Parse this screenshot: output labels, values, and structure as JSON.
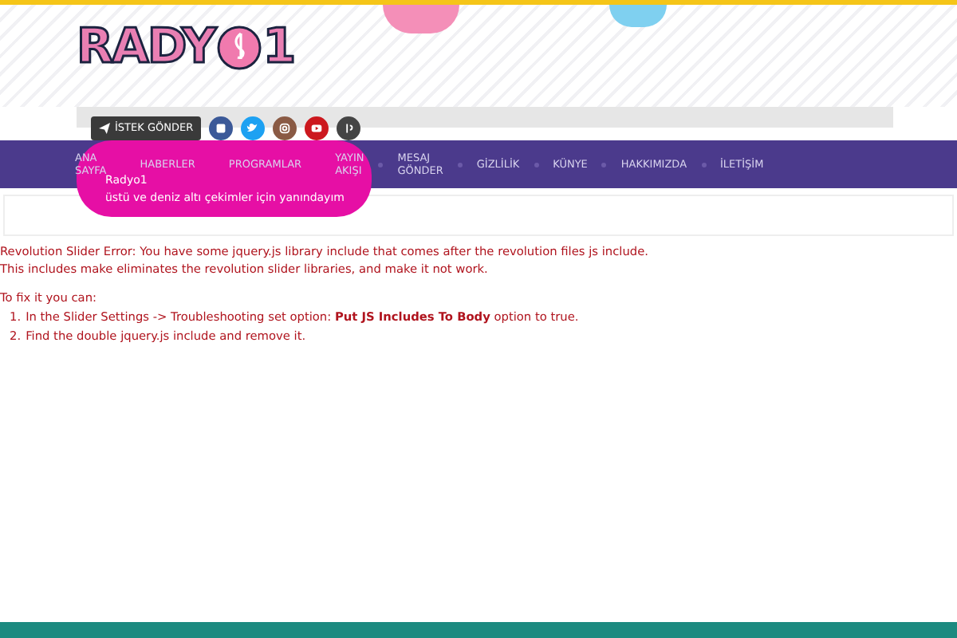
{
  "logo": {
    "text": "RADY",
    "suffix": "1"
  },
  "request_button": {
    "label": "İSTEK GÖNDER"
  },
  "social_links": [
    {
      "kind": "facebook",
      "color": "#3b5998"
    },
    {
      "kind": "twitter",
      "color": "#1da1f2"
    },
    {
      "kind": "instagram",
      "color": "#8a5a44"
    },
    {
      "kind": "youtube",
      "color": "#cc181e"
    },
    {
      "kind": "other",
      "color": "#444444"
    }
  ],
  "nav": {
    "items": [
      {
        "label": "ANA SAYFA"
      },
      {
        "label": "HABERLER"
      },
      {
        "label": "PROGRAMLAR"
      },
      {
        "label": "YAYIN AKIŞI"
      },
      {
        "label": "MESAJ GÖNDER"
      },
      {
        "label": "GİZLİLİK"
      },
      {
        "label": "KÜNYE"
      },
      {
        "label": "HAKKIMIZDA"
      },
      {
        "label": "İLETİŞİM"
      }
    ]
  },
  "popup": {
    "title": "Radyo1",
    "text": "üstü ve deniz altı çekimler için yanındayım"
  },
  "error": {
    "lines": [
      "Revolution Slider Error: You have some jquery.js library include that comes after the revolution files js include.",
      "This includes make eliminates the revolution slider libraries, and make it not work."
    ],
    "fix_heading": "To fix it you can:",
    "steps": [
      {
        "number": "1.",
        "text": "In the Slider Settings -> Troubleshooting set option: **Put JS Includes To Body** option to true."
      },
      {
        "number": "2.",
        "text": "Find the double jquery.js include and remove it."
      }
    ]
  }
}
